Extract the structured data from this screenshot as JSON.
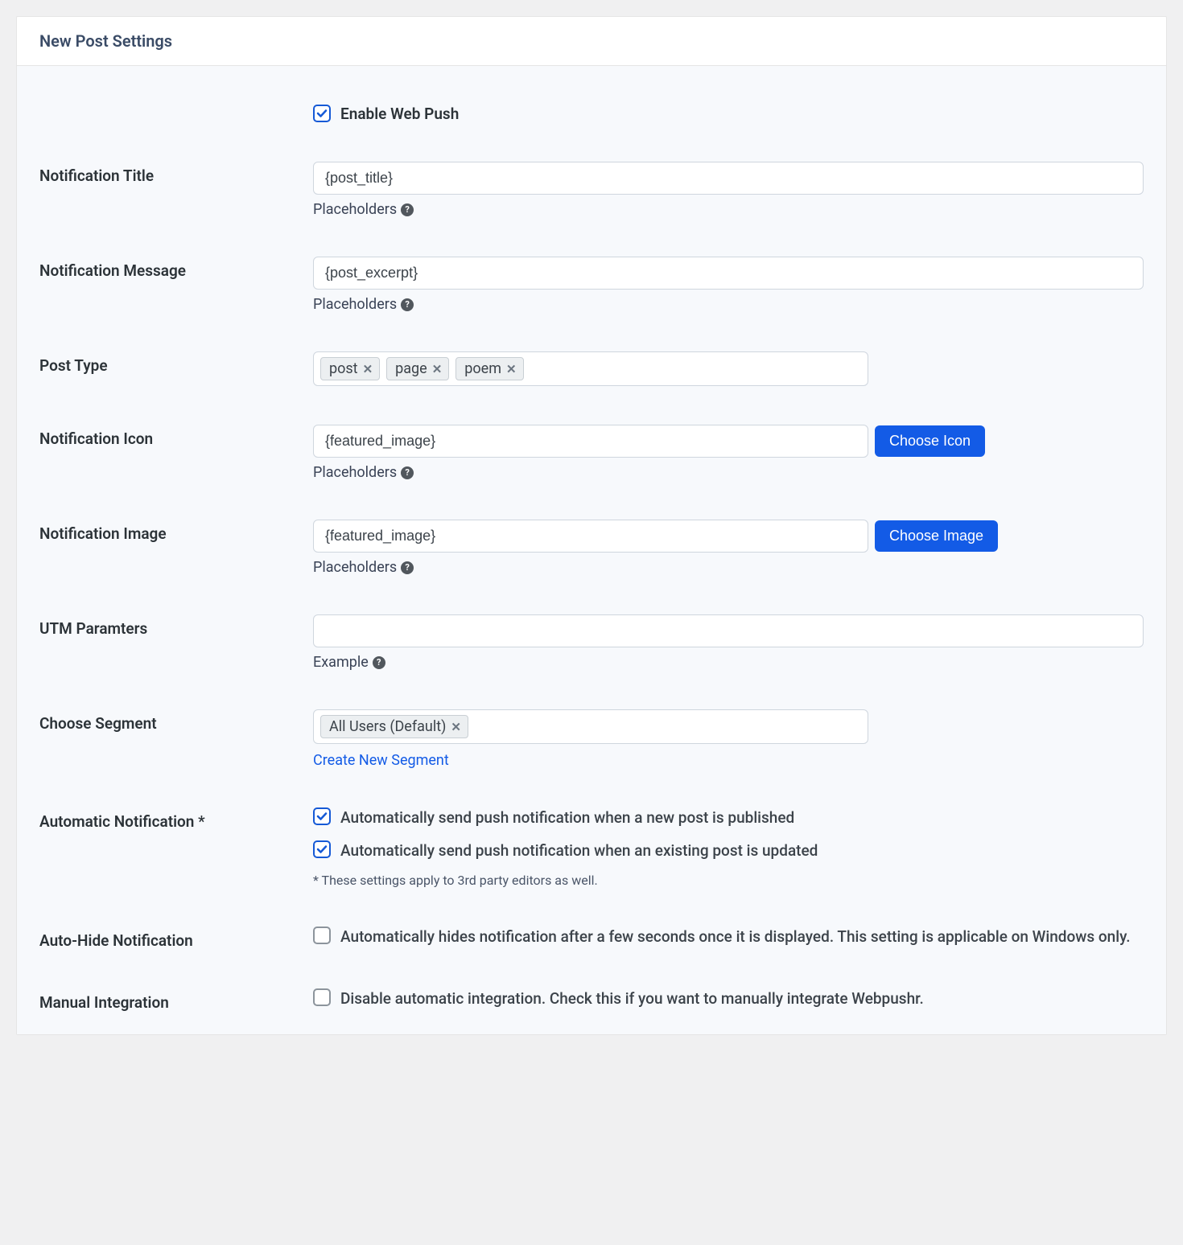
{
  "panel": {
    "title": "New Post Settings"
  },
  "enable": {
    "label": "Enable Web Push",
    "checked": true
  },
  "fields": {
    "notif_title": {
      "label": "Notification Title",
      "value": "{post_title}",
      "helper": "Placeholders"
    },
    "notif_message": {
      "label": "Notification Message",
      "value": "{post_excerpt}",
      "helper": "Placeholders"
    },
    "post_type": {
      "label": "Post Type",
      "tags": [
        "post",
        "page",
        "poem"
      ]
    },
    "notif_icon": {
      "label": "Notification Icon",
      "value": "{featured_image}",
      "button": "Choose Icon",
      "helper": "Placeholders"
    },
    "notif_image": {
      "label": "Notification Image",
      "value": "{featured_image}",
      "button": "Choose Image",
      "helper": "Placeholders"
    },
    "utm": {
      "label": "UTM Paramters",
      "value": "",
      "helper": "Example"
    },
    "segment": {
      "label": "Choose Segment",
      "tags": [
        "All Users (Default)"
      ],
      "link": "Create New Segment"
    },
    "auto_notif": {
      "label": "Automatic Notification *",
      "opt1": "Automatically send push notification when a new post is published",
      "opt2": "Automatically send push notification when an existing post is updated",
      "opt1_checked": true,
      "opt2_checked": true,
      "note": "* These settings apply to 3rd party editors as well."
    },
    "auto_hide": {
      "label": "Auto-Hide Notification",
      "desc": "Automatically hides notification after a few seconds once it is displayed. This setting is applicable on Windows only.",
      "checked": false
    },
    "manual": {
      "label": "Manual Integration",
      "desc": "Disable automatic integration. Check this if you want to manually integrate Webpushr.",
      "checked": false
    }
  }
}
